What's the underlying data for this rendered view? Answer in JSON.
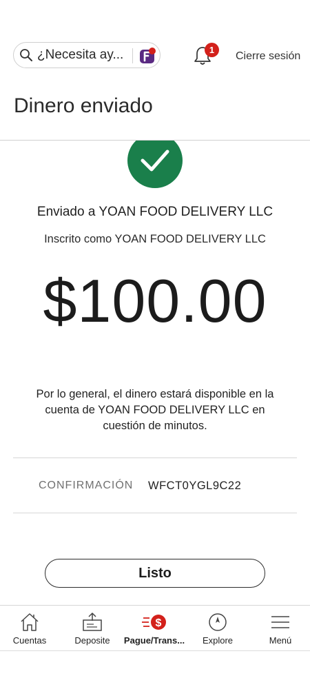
{
  "header": {
    "search_placeholder": "¿Necesita ay...",
    "notification_count": "1",
    "logout_label": "Cierre sesión"
  },
  "page": {
    "title": "Dinero enviado"
  },
  "confirmation": {
    "sent_to": "Enviado a YOAN FOOD DELIVERY LLC",
    "enrolled_as": "Inscrito como YOAN FOOD DELIVERY LLC",
    "amount": "$100.00",
    "note": "Por lo general, el dinero estará disponible en la cuenta de YOAN FOOD DELIVERY LLC en cuestión de minutos.",
    "confirmation_label": "CONFIRMACIÓN",
    "confirmation_number": "WFCT0YGL9C22",
    "done_label": "Listo"
  },
  "bottom_nav": {
    "items": [
      {
        "label": "Cuentas",
        "icon": "home-icon"
      },
      {
        "label": "Deposite",
        "icon": "deposit-icon"
      },
      {
        "label": "Pague/Trans...",
        "icon": "pay-transfer-icon",
        "active": true
      },
      {
        "label": "Explore",
        "icon": "compass-icon"
      },
      {
        "label": "Menú",
        "icon": "hamburger-menu-icon"
      }
    ]
  },
  "colors": {
    "success_green": "#1a7f4b",
    "badge_red": "#d3211b",
    "fargo_purple": "#5a2a82",
    "fargo_red": "#d3211b"
  }
}
